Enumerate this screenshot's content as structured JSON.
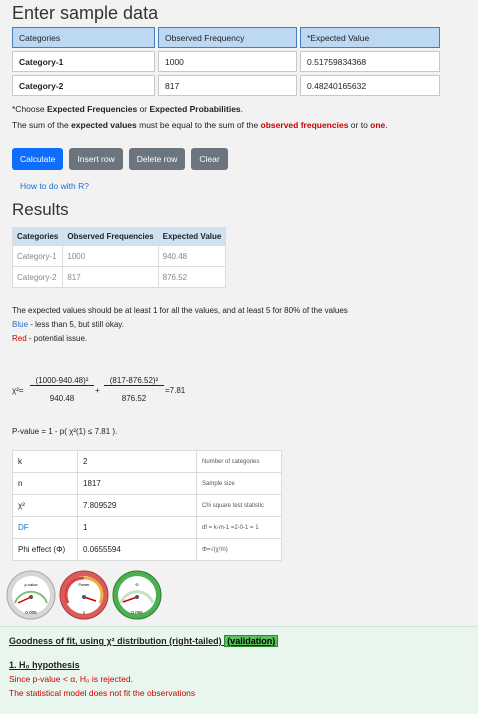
{
  "heading": "Enter sample data",
  "input_table": {
    "headers": [
      "Categories",
      "Observed Frequency",
      "*Expected Value"
    ],
    "rows": [
      [
        "Category-1",
        "1000",
        "0.51759834368"
      ],
      [
        "Category-2",
        "817",
        "0.48240165632"
      ]
    ]
  },
  "note": {
    "line1_a": "*Choose ",
    "line1_b": "Expected Frequencies",
    "line1_c": " or ",
    "line1_d": "Expected Probabilities",
    "line1_e": ".",
    "line2_a": "The sum of the ",
    "line2_b": "expected values",
    "line2_c": " must be equal to the sum of the ",
    "line2_d": "observed frequencies",
    "line2_e": " or to ",
    "line2_f": "one",
    "line2_g": "."
  },
  "buttons": {
    "calculate": "Calculate",
    "insert": "Insert row",
    "delete": "Delete row",
    "clear": "Clear"
  },
  "link": "How to do with R?",
  "results_heading": "Results",
  "results_table": {
    "headers": [
      "Categories",
      "Observed Frequencies",
      "Expected Value"
    ],
    "rows": [
      [
        "Category-1",
        "1000",
        "940.48"
      ],
      [
        "Category-2",
        "817",
        "876.52"
      ]
    ]
  },
  "rule": {
    "line1": "The expected values should be at least 1 for all the values, and at least 5 for 80% of the values",
    "blue_a": "Blue",
    "blue_b": " - less than 5, but still okay.",
    "red_a": "Red",
    "red_b": " - potential issue."
  },
  "formula": {
    "lhs": "χ²=",
    "num1": "(1000-940.48)²",
    "den1": "940.48",
    "plus": "+",
    "num2": "(817-876.52)²",
    "den2": "876.52",
    "rhs": "=7.81"
  },
  "pvalue": "P-value = 1 - p( χ²(1) ≤ 7.81 ).",
  "stats": [
    {
      "k": "k",
      "v": "2",
      "d": "Number of categories",
      "blue": false
    },
    {
      "k": "n",
      "v": "1817",
      "d": "Sample size",
      "blue": false
    },
    {
      "k": "χ²",
      "v": "7.809529",
      "d": "Chi square test statistic",
      "blue": false
    },
    {
      "k": "DF",
      "v": "1",
      "d": "df = k-m-1 =2-0-1 = 1",
      "blue": true
    },
    {
      "k": "Phi effect (Φ)",
      "v": "0.0655594",
      "d": "Φ=√(χ²/n)",
      "blue": false
    }
  ],
  "gauges": [
    {
      "label": "p-value",
      "value": "0.005"
    },
    {
      "label": "Power",
      "value": "1"
    },
    {
      "label": "Φ",
      "value": "0.066"
    }
  ],
  "gof": {
    "title": "Goodness of fit, using χ² distribution (right-tailed)",
    "validation": "(validation)",
    "hyp": "1. H₀ hypothesis",
    "line1": "Since p-value < α, H₀ is rejected.",
    "line2": "The statistical model does not fit the observations"
  },
  "colors": {
    "primary": "#0d6efd",
    "secondary": "#6c757d",
    "header": "#bcd8f3",
    "reject": "#cc0000",
    "valid": "#5cc25c"
  }
}
